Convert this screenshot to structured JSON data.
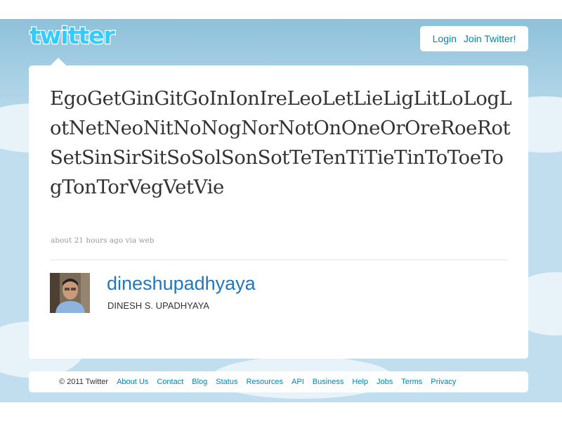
{
  "header": {
    "logo_text": "twitter",
    "login_label": "Login",
    "join_label": "Join Twitter!"
  },
  "tweet": {
    "text": "EgoGetGinGitGoInIonIreLeoLetLieLigLitLoLogLotNetNeoNitNoNogNorNotOnOneOrOreRoeRotSetSinSirSitSoSolSonSotTeTenTiTieTinToToeTogTonTorVegVetVie",
    "timestamp": "about 21 hours ago",
    "via_prefix": "via",
    "source": "web"
  },
  "user": {
    "screen_name": "dineshupadhyaya",
    "full_name": "DINESH S. UPADHYAYA"
  },
  "footer": {
    "copyright": "© 2011 Twitter",
    "links": [
      "About Us",
      "Contact",
      "Blog",
      "Status",
      "Resources",
      "API",
      "Business",
      "Help",
      "Jobs",
      "Terms",
      "Privacy"
    ]
  },
  "colors": {
    "background": "#c0deed",
    "link": "#0084b4",
    "screen_name": "#2276bb",
    "logo": "#33ccff"
  }
}
